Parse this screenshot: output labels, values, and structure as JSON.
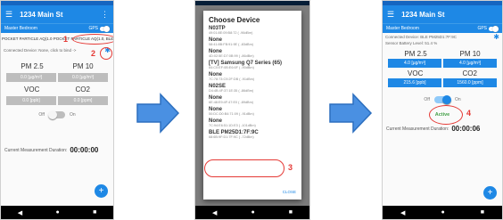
{
  "app": {
    "title": "1234 Main St",
    "room": "Master Bedroom",
    "gps_label": "GPS"
  },
  "screen1": {
    "device_dropdown": "POCKET PARTICLE AQ(1.0 POCKET PARTICLE AQ(1.0, BLE",
    "connected": "Connected Device: None, click to bind ->",
    "pm25": "PM 2.5",
    "pm10": "PM 10",
    "pm25_val": "0.0 [µg/m³]",
    "pm10_val": "0.0 [µg/m³]",
    "voc": "VOC",
    "co2": "CO2",
    "voc_val": "0.0 [ppb]",
    "co2_val": "0.0 [ppm]",
    "off": "Off",
    "on": "On",
    "duration_label": "Current Measurement Duration:",
    "duration": "00:00:00"
  },
  "dialog": {
    "title": "Choose Device",
    "devices": [
      {
        "name": "N03TP",
        "addr": "49:01:8E:09:B8:72 ( -96dBm)"
      },
      {
        "name": "None",
        "addr": "58:41:8B:FB:91:9E ( -83dBm)"
      },
      {
        "name": "None",
        "addr": "4D:02:5E:D7:0B:99 ( -86dBm)"
      },
      {
        "name": "[TV] Samsung Q7 Series (65)",
        "addr": "84:C0:EF:0B:E6:6F ( -90dBm)"
      },
      {
        "name": "None",
        "addr": "7C:78:73:C9:2F:DB ( -91dBm)"
      },
      {
        "name": "N02SE",
        "addr": "D4:4B:4F:37:1E:35 ( -86dBm)"
      },
      {
        "name": "None",
        "addr": "6E:48:E9:4F:47:E0 ( -89dBm)"
      },
      {
        "name": "None",
        "addr": "50:DC:D0:B4:71:09 ( -91dBm)"
      },
      {
        "name": "None",
        "addr": "7C:94:E6:51:1D:E3 ( -101dBm)"
      },
      {
        "name": "BLE PM25D1:7F:9C",
        "addr": "68:6B:9F:D1:7F:9C ( -72dBm)"
      }
    ],
    "close": "CLOSE"
  },
  "screen3": {
    "connected": "Connected Device: BLE PM25D1:7F:9C",
    "battery": "Sensor Battery Level: 51.4 %",
    "pm25": "PM 2.5",
    "pm10": "PM 10",
    "pm25_val": "4.0 [µg/m³]",
    "pm10_val": "4.0 [µg/m³]",
    "voc": "VOC",
    "co2": "CO2",
    "voc_val": "215.6 [ppb]",
    "co2_val": "1560.0 [ppm]",
    "off": "Off",
    "on": "On",
    "active": "Active",
    "duration_label": "Current Measurement Duration:",
    "duration": "00:00:06"
  },
  "annotations": [
    "1",
    "2",
    "3",
    "4"
  ],
  "colors": {
    "accent": "#1e88e5",
    "annotation": "#e53935",
    "active": "#43a047"
  }
}
